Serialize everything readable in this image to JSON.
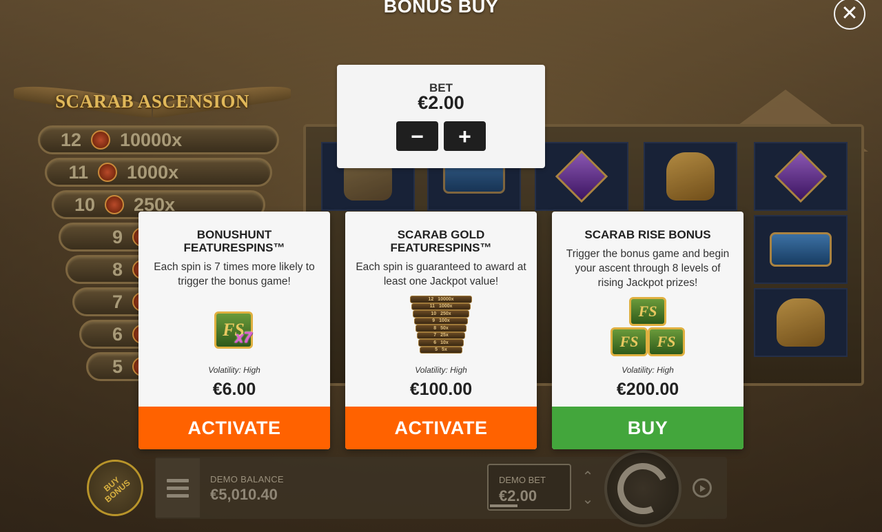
{
  "modal": {
    "title": "BONUS BUY",
    "close_icon": "close-icon"
  },
  "bet": {
    "label": "BET",
    "value": "€2.00",
    "minus": "−",
    "plus": "+"
  },
  "cards": [
    {
      "title_line1": "BONUSHUNT",
      "title_line2": "FEATURESPINS™",
      "description": "Each spin is 7 times more likely to trigger the bonus game!",
      "badge_text": "FS",
      "badge_multiplier": "x7",
      "volatility": "Volatility: High",
      "price": "€6.00",
      "action": "ACTIVATE",
      "action_color": "#ff6200"
    },
    {
      "title_line1": "SCARAB GOLD",
      "title_line2": "FEATURESPINS™",
      "description": "Each spin is guaranteed to award at least one Jackpot value!",
      "volatility": "Volatility: High",
      "price": "€100.00",
      "action": "ACTIVATE",
      "action_color": "#ff6200"
    },
    {
      "title_line1": "SCARAB RISE BONUS",
      "title_line2": "",
      "description": "Trigger the bonus game and begin your ascent through 8 levels of rising Jackpot prizes!",
      "badge_text": "FS",
      "volatility": "Volatility: High",
      "price": "€200.00",
      "action": "BUY",
      "action_color": "#43a63c"
    }
  ],
  "jackpot_mini": [
    {
      "level": "12",
      "mult": "10000x"
    },
    {
      "level": "11",
      "mult": "1000x"
    },
    {
      "level": "10",
      "mult": "250x"
    },
    {
      "level": "9",
      "mult": "100x"
    },
    {
      "level": "8",
      "mult": "50x"
    },
    {
      "level": "7",
      "mult": "25x"
    },
    {
      "level": "6",
      "mult": "10x"
    },
    {
      "level": "5",
      "mult": "5x"
    }
  ],
  "game": {
    "logo": "SCARAB ASCENSION",
    "ladder": [
      {
        "level": "12",
        "mult": "10000x"
      },
      {
        "level": "11",
        "mult": "1000x"
      },
      {
        "level": "10",
        "mult": "250x"
      },
      {
        "level": "9",
        "mult": ""
      },
      {
        "level": "8",
        "mult": ""
      },
      {
        "level": "7",
        "mult": ""
      },
      {
        "level": "6",
        "mult": ""
      },
      {
        "level": "5",
        "mult": ""
      }
    ]
  },
  "bottom_bar": {
    "buy_bonus_line1": "BUY",
    "buy_bonus_line2": "BONUS",
    "balance_label": "DEMO BALANCE",
    "balance_value": "€5,010.40",
    "bet_label": "DEMO BET",
    "bet_value": "€2.00"
  }
}
